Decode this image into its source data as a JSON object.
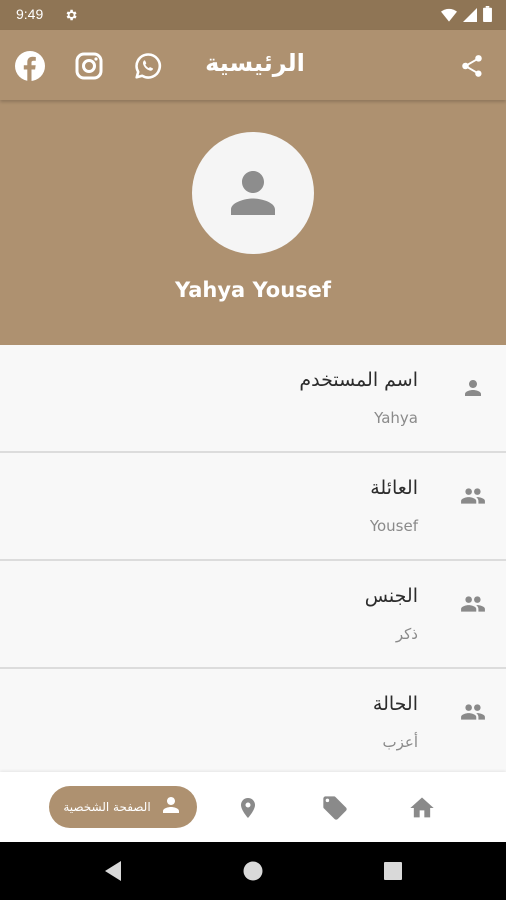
{
  "status_bar": {
    "time": "9:49"
  },
  "app_bar": {
    "title": "الرئيسية",
    "icons": [
      "facebook-icon",
      "instagram-icon",
      "whatsapp-icon",
      "share-icon"
    ]
  },
  "profile": {
    "name": "Yahya Yousef"
  },
  "info_rows": [
    {
      "label": "اسم المستخدم",
      "value": "Yahya",
      "icon": "person-icon"
    },
    {
      "label": "العائلة",
      "value": "Yousef",
      "icon": "people-icon"
    },
    {
      "label": "الجنس",
      "value": "ذكر",
      "icon": "people-icon"
    },
    {
      "label": "الحالة",
      "value": "أعزب",
      "icon": "people-icon"
    }
  ],
  "bottom_nav": {
    "active_label": "الصفحة الشخصية",
    "items": [
      "profile-icon",
      "location-pin-icon",
      "tag-icon",
      "home-icon"
    ]
  },
  "colors": {
    "primary": "#ae9170",
    "status_bar": "#8f7555",
    "icon_gray": "#8a8a8a"
  }
}
